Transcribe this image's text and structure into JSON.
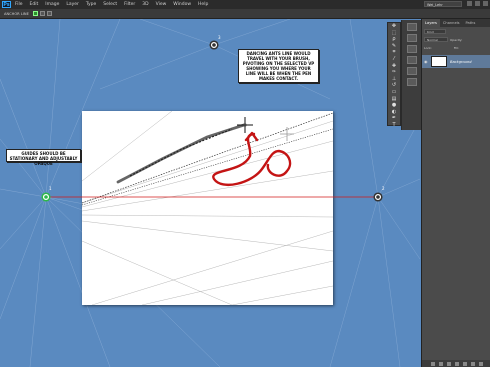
{
  "app": {
    "logo": "Ps"
  },
  "menu": [
    "File",
    "Edit",
    "Image",
    "Layer",
    "Type",
    "Select",
    "Filter",
    "3D",
    "View",
    "Window",
    "Help"
  ],
  "workspace_select": "Wei_Lehr",
  "options": {
    "tool_label": "ANCHOR LINE"
  },
  "notes": {
    "ants": "Dancing ants line would travel with your brush, pivoting on the selected vp showing you where your line will be when the pen makes contact.",
    "guides": "Guides should be stationary and adjustably opaque"
  },
  "vanishing_points": {
    "left_label": "1",
    "right_label": "2",
    "top_label": "3"
  },
  "panel": {
    "tabs": [
      "Layers",
      "Channels",
      "Paths"
    ],
    "kind": "Kind",
    "blend": "Normal",
    "opacity": "Opacity:",
    "lock": "Lock:",
    "fill": "Fill:",
    "layer_name": "Background"
  },
  "colors": {
    "workspace_bg": "#5a8ac0",
    "guide_red": "#d21a1a",
    "vp_left_green": "#2db84a",
    "scribble_red": "#c41414"
  }
}
